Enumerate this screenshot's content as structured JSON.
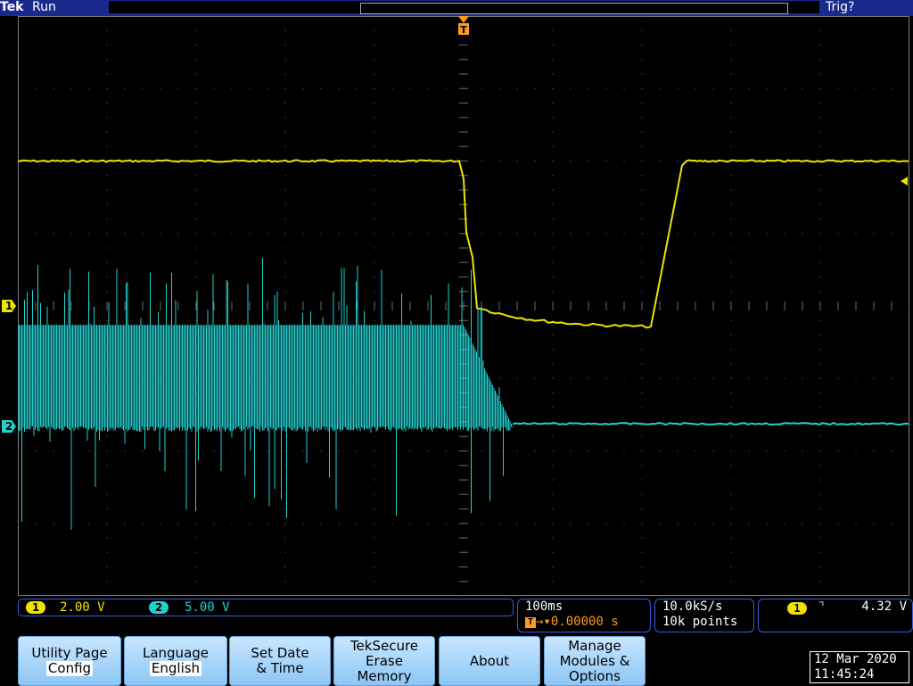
{
  "header": {
    "brand": "Tek",
    "run_state": "Run",
    "trigger_state": "Trig?",
    "trigger_marker": "T"
  },
  "channels": [
    {
      "id": "1",
      "scale": "2.00 V",
      "color": "#f0e200"
    },
    {
      "id": "2",
      "scale": "5.00 V",
      "color": "#22d0d0"
    }
  ],
  "timebase": {
    "scale": "100ms",
    "trigger_position": "0.00000 s",
    "sample_rate": "10.0kS/s",
    "record_length": "10k points"
  },
  "trigger": {
    "source": "1",
    "slope_icon": "falling-edge-icon",
    "level": "4.32 V"
  },
  "menu": {
    "buttons": [
      {
        "name": "utility-page",
        "line1": "Utility Page",
        "line2": "Config",
        "selected_value": true
      },
      {
        "name": "language",
        "line1": "Language",
        "line2": "English",
        "selected_value": true
      },
      {
        "name": "set-date-time",
        "line1": "Set Date",
        "line2": "& Time",
        "selected_value": false
      },
      {
        "name": "teksecure",
        "line1": "TekSecure",
        "line2": "Erase",
        "line3": "Memory",
        "selected_value": false
      },
      {
        "name": "about",
        "line1": "About",
        "line2": "",
        "selected_value": false
      },
      {
        "name": "manage-modules",
        "line1": "Manage",
        "line2": "Modules &",
        "line3": "Options",
        "selected_value": false
      }
    ]
  },
  "datetime": {
    "date": "12 Mar 2020",
    "time": "11:45:24"
  },
  "waveforms": {
    "ch1": {
      "high_level_div": 2.0,
      "low_level_div": -0.3
    },
    "ch2": {
      "burst_amplitude_div": 1.4
    }
  },
  "colors": {
    "ch1": "#f0e200",
    "ch2": "#22d0d0",
    "accent": "#ff9a1a",
    "frame": "#1a2a8c",
    "grid": "#6a6a6a"
  }
}
